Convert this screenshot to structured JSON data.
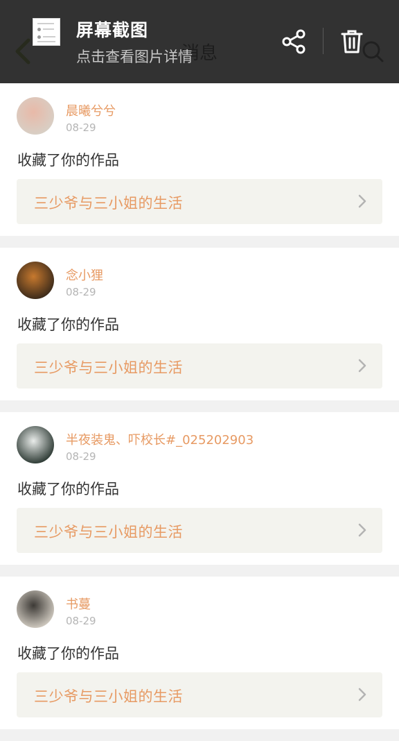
{
  "app": {
    "title": "消息",
    "back_icon": "chevron-left-icon",
    "search_icon": "search-icon"
  },
  "screenshot_notice": {
    "title": "屏幕截图",
    "subtitle": "点击查看图片详情",
    "share_icon": "share-icon",
    "delete_icon": "trash-icon"
  },
  "messages": [
    {
      "user": "晨曦兮兮",
      "date": "08-29",
      "action": "收藏了你的作品",
      "work_title": "三少爷与三小姐的生活",
      "avatar_colors": [
        "#d8cfc5",
        "#e8b9a8"
      ]
    },
    {
      "user": "念小狸",
      "date": "08-29",
      "action": "收藏了你的作品",
      "work_title": "三少爷与三小姐的生活",
      "avatar_colors": [
        "#3b2a1a",
        "#c7792e"
      ]
    },
    {
      "user": "半夜装鬼、吓校长#_025202903",
      "date": "08-29",
      "action": "收藏了你的作品",
      "work_title": "三少爷与三小姐的生活",
      "avatar_colors": [
        "#2d3a34",
        "#e9ecea"
      ]
    },
    {
      "user": "书蔓",
      "date": "08-29",
      "action": "收藏了你的作品",
      "work_title": "三少爷与三小姐的生活",
      "avatar_colors": [
        "#cfc9bf",
        "#3d3a36"
      ]
    }
  ],
  "colors": {
    "accent": "#e79a63",
    "card_link_bg": "#f3f3ee",
    "overlay_bg": "#1e1e1e"
  }
}
